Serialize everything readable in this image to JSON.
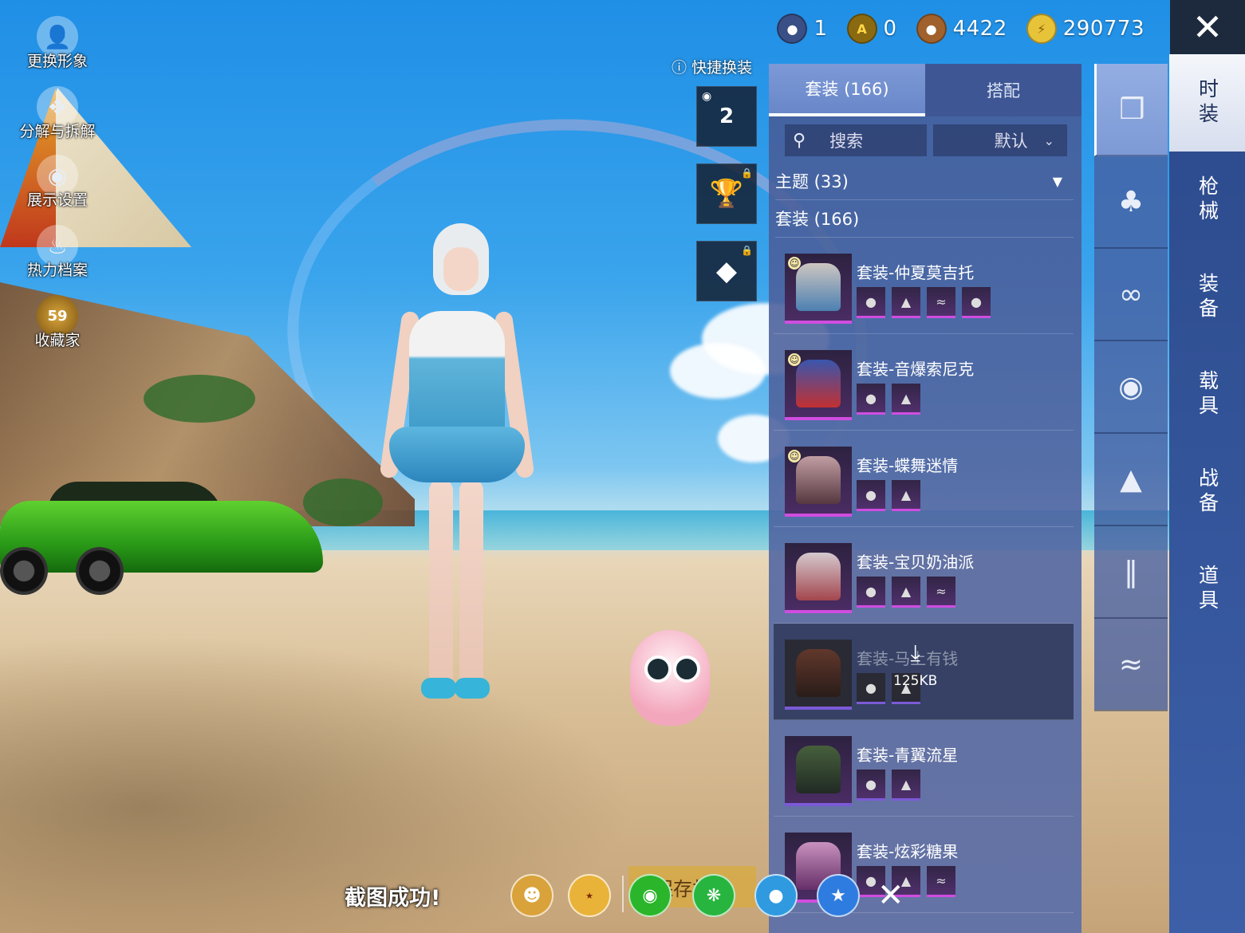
{
  "left_menu": [
    {
      "label": "更换形象",
      "icon": "avatar-icon"
    },
    {
      "label": "分解与拆解",
      "icon": "puzzle-icon"
    },
    {
      "label": "展示设置",
      "icon": "eye-icon"
    },
    {
      "label": "热力档案",
      "icon": "flame-icon"
    },
    {
      "label": "收藏家",
      "icon": "collector-badge-icon",
      "badge": "59"
    }
  ],
  "currencies": [
    {
      "icon": "coin-blue-icon",
      "value": "1",
      "color": "#6d7fb8"
    },
    {
      "icon": "coin-a-icon",
      "value": "0",
      "color": "#caa41c"
    },
    {
      "icon": "coin-bronze-icon",
      "value": "4422",
      "color": "#a0612c"
    },
    {
      "icon": "coin-lightning-icon",
      "value": "290773",
      "color": "#e7c33a"
    }
  ],
  "quick_outfit": {
    "label": "快捷换装",
    "slot_number": "2"
  },
  "panel": {
    "tabs": [
      {
        "label": "套装 (166)",
        "active": true
      },
      {
        "label": "搭配",
        "active": false
      }
    ],
    "search_label": "搜索",
    "sort_label": "默认",
    "theme_row": "主题 (33)",
    "suit_row": "套装 (166)",
    "items": [
      {
        "name": "套装-仲夏莫吉托",
        "parts": 4,
        "emoji": true,
        "rarity": "pink"
      },
      {
        "name": "套装-音爆索尼克",
        "parts": 2,
        "emoji": true,
        "rarity": "pink"
      },
      {
        "name": "套装-蝶舞迷情",
        "parts": 2,
        "emoji": true,
        "rarity": "pink"
      },
      {
        "name": "套装-宝贝奶油派",
        "parts": 3,
        "emoji": false,
        "rarity": "pink"
      },
      {
        "name": "套装-马上有钱",
        "parts": 2,
        "emoji": false,
        "rarity": "dark",
        "download": "125KB"
      },
      {
        "name": "套装-青翼流星",
        "parts": 2,
        "emoji": false,
        "rarity": "purple"
      },
      {
        "name": "套装-炫彩糖果",
        "parts": 3,
        "emoji": false,
        "rarity": "pink"
      }
    ]
  },
  "category_strip": [
    "suit-icon",
    "hair-icon",
    "glasses-icon",
    "mask-icon",
    "top-icon",
    "pants-icon",
    "shoes-icon"
  ],
  "nav": [
    {
      "label": "时装",
      "active": true
    },
    {
      "label": "枪械",
      "active": false
    },
    {
      "label": "装备",
      "active": false
    },
    {
      "label": "载具",
      "active": false
    },
    {
      "label": "战备",
      "active": false
    },
    {
      "label": "道具",
      "active": false
    }
  ],
  "screenshot": {
    "toast": "截图成功!",
    "save_label": "保存相册"
  }
}
